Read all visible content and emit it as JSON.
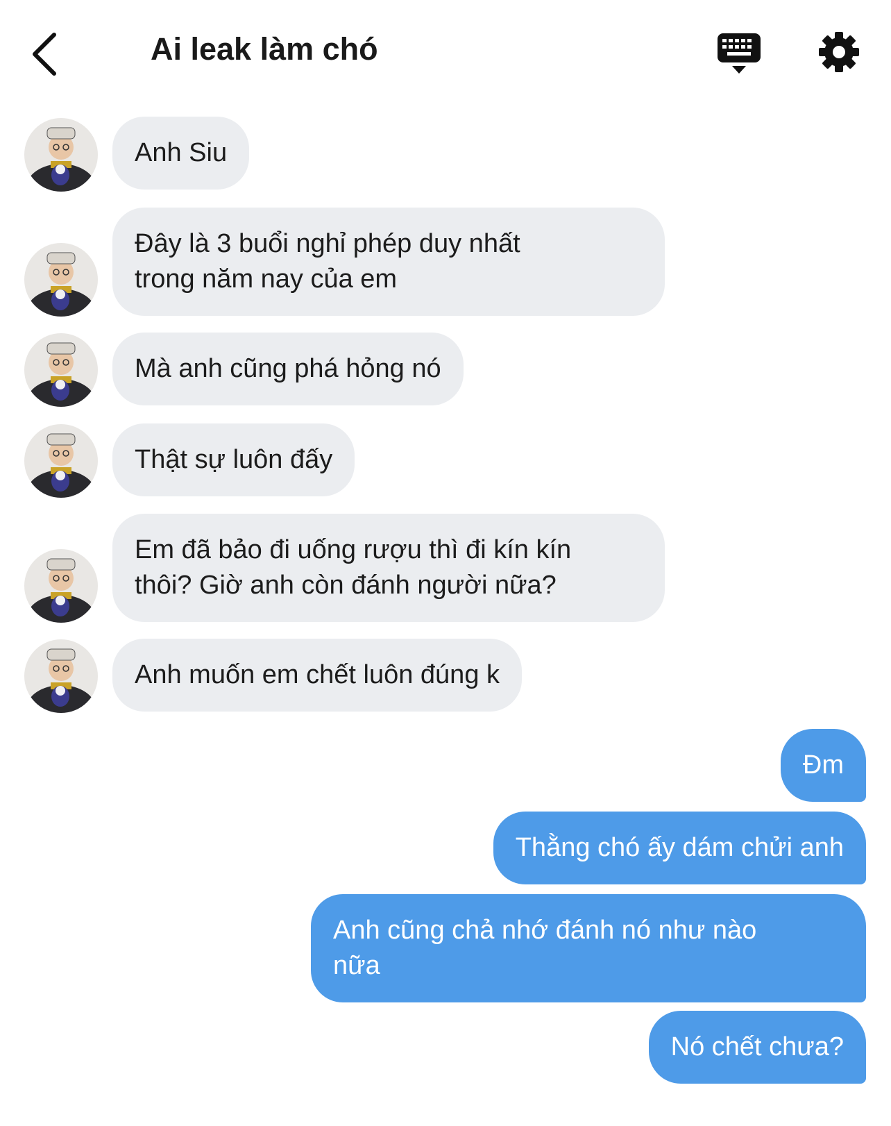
{
  "header": {
    "title": "Ai leak làm chó",
    "back_icon": "chevron-left-icon",
    "keyboard_icon": "keyboard-icon",
    "settings_icon": "gear-icon"
  },
  "colors": {
    "incoming_bubble": "#ebedf0",
    "outgoing_bubble": "#4e9be8"
  },
  "messages": [
    {
      "from": "other",
      "lines": [
        "Anh Siu"
      ]
    },
    {
      "from": "other",
      "lines": [
        "Đây là 3 buổi nghỉ phép duy nhất",
        "trong năm nay của em"
      ]
    },
    {
      "from": "other",
      "lines": [
        "Mà anh cũng phá hỏng nó"
      ]
    },
    {
      "from": "other",
      "lines": [
        "Thật sự luôn đấy"
      ]
    },
    {
      "from": "other",
      "lines": [
        "Em đã bảo đi uống rượu thì đi kín kín",
        "thôi? Giờ anh còn đánh người nữa?"
      ]
    },
    {
      "from": "other",
      "lines": [
        "Anh muốn em chết luôn đúng k"
      ]
    },
    {
      "from": "me",
      "lines": [
        "Đm"
      ]
    },
    {
      "from": "me",
      "lines": [
        "Thằng chó ấy dám chửi anh"
      ]
    },
    {
      "from": "me",
      "lines": [
        "Anh cũng chả nhớ đánh nó như nào",
        "nữa"
      ]
    },
    {
      "from": "me",
      "lines": [
        "Nó chết chưa?"
      ]
    }
  ]
}
